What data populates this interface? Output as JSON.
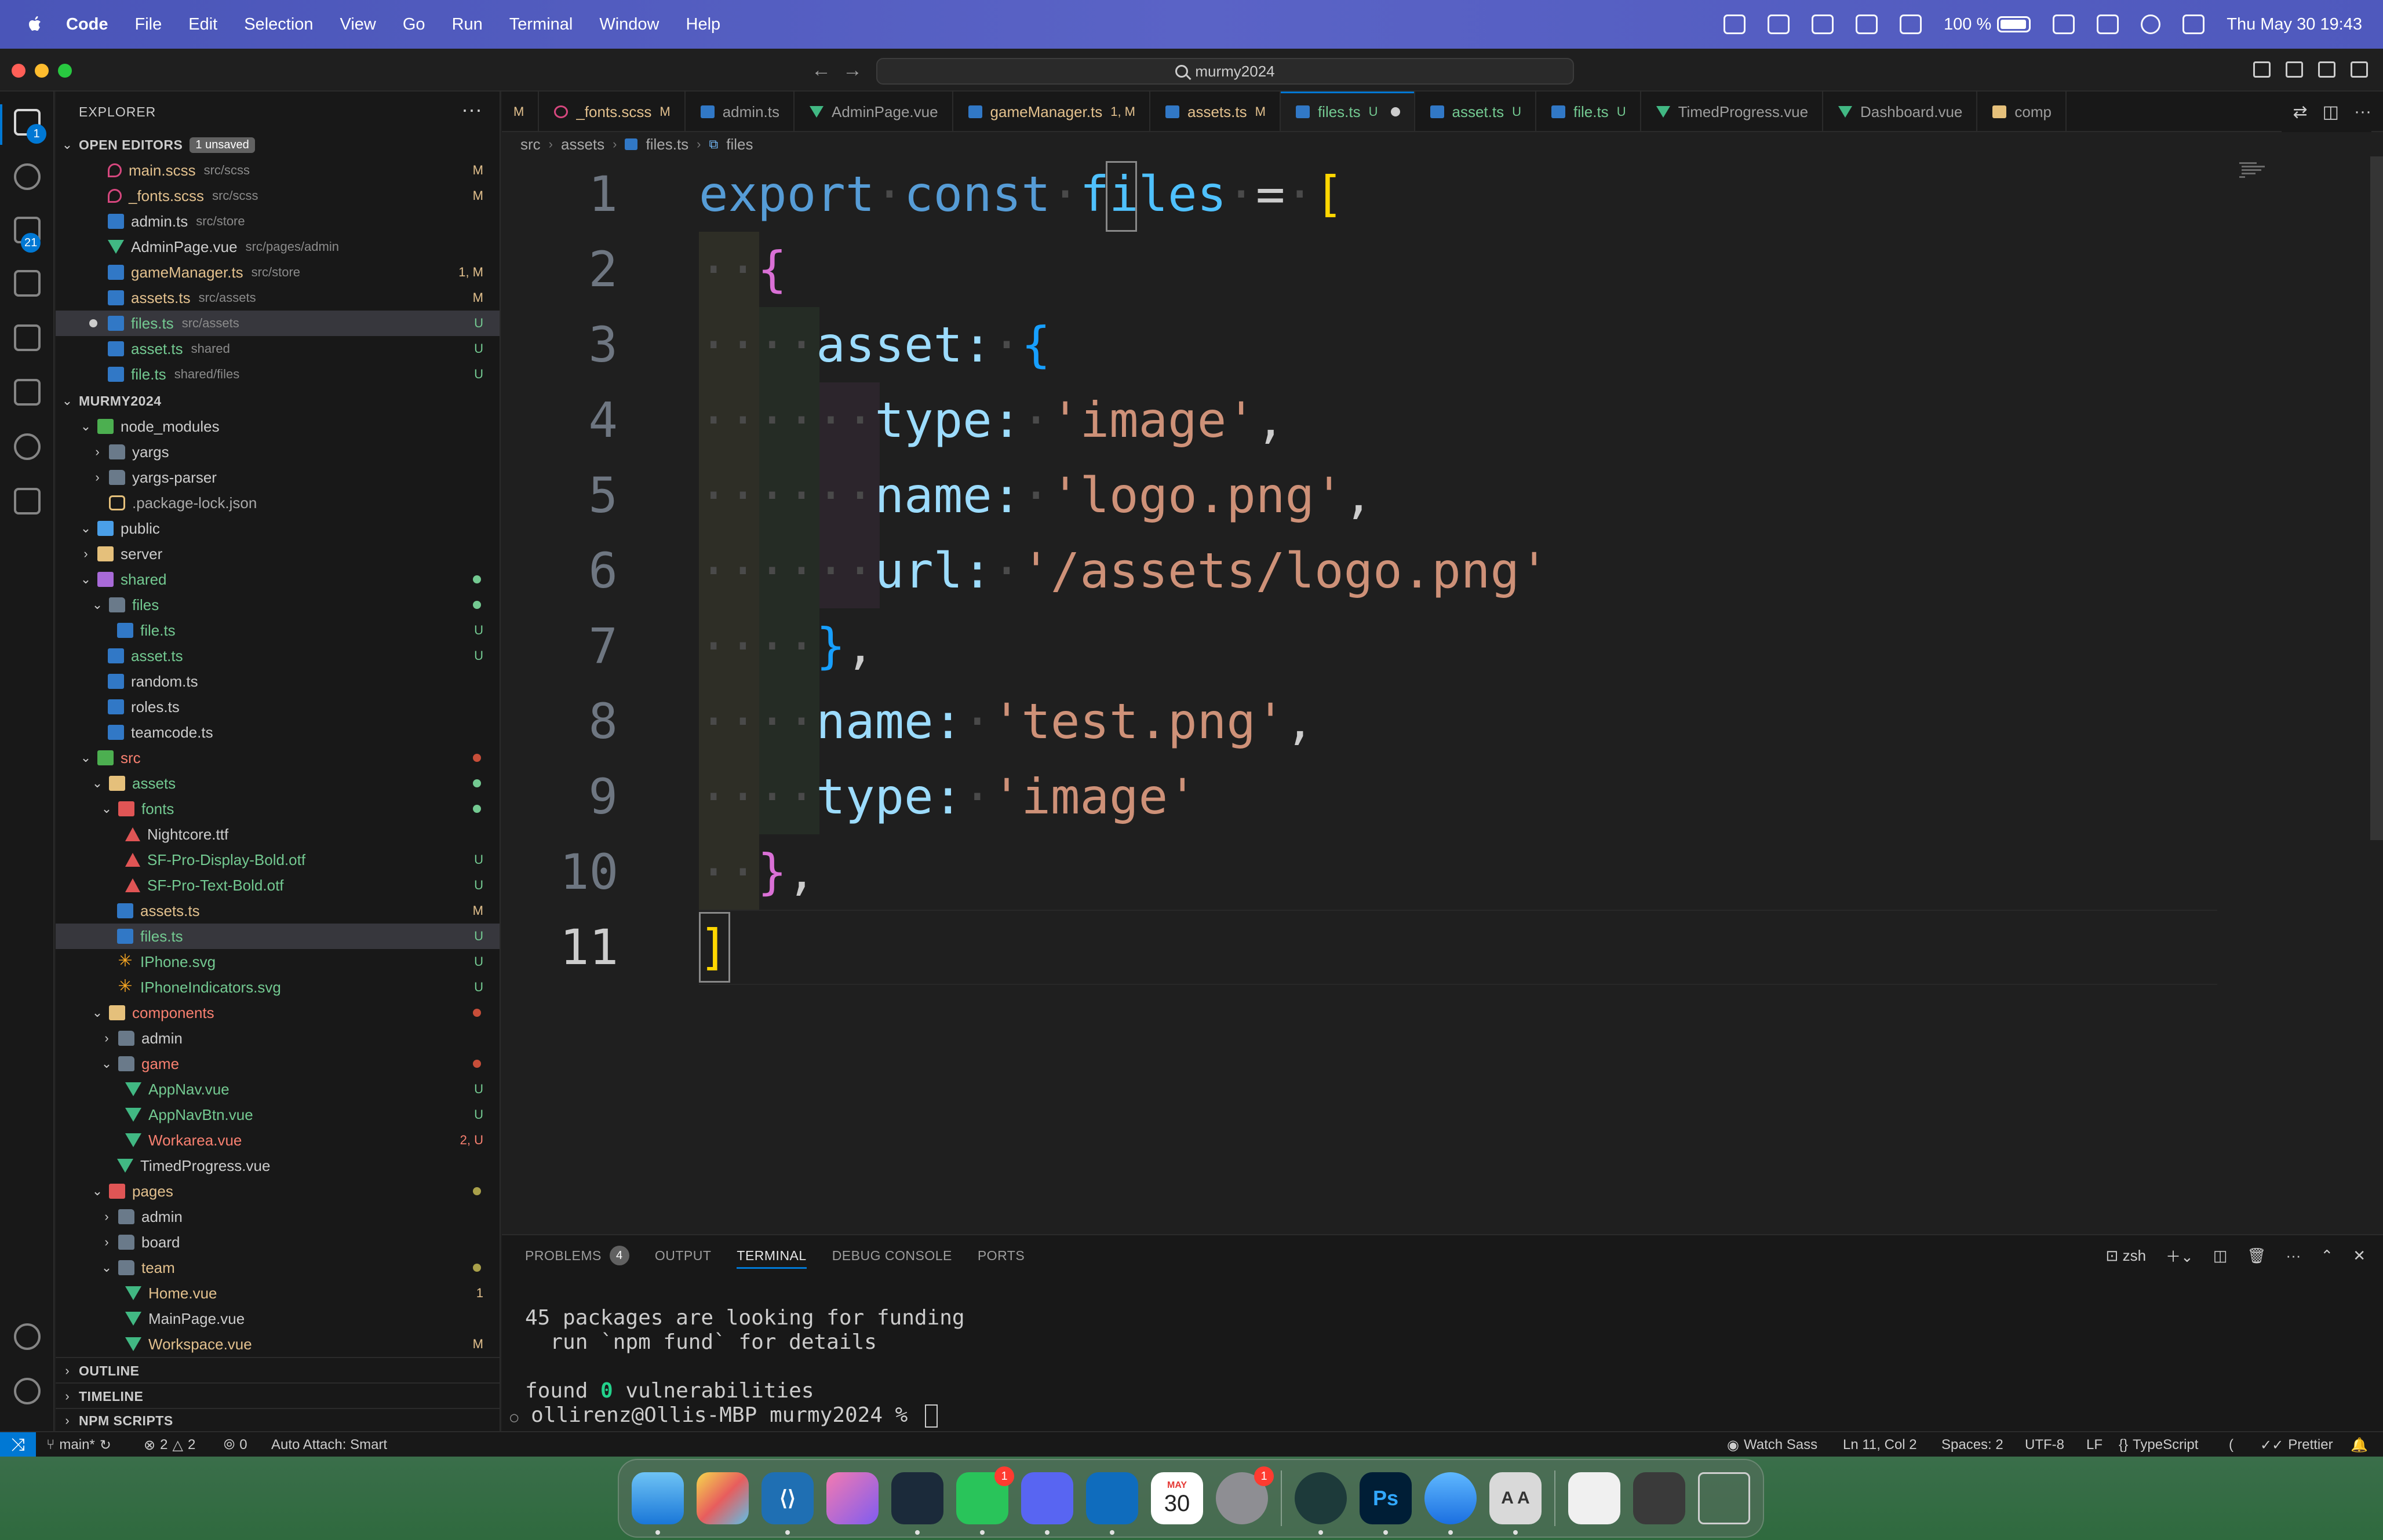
{
  "menubar": {
    "app_name": "Code",
    "menus": [
      "File",
      "Edit",
      "Selection",
      "View",
      "Go",
      "Run",
      "Terminal",
      "Window",
      "Help"
    ],
    "battery": "100 %",
    "datetime": "Thu May 30  19:43"
  },
  "titlebar": {
    "search": "murmy2024"
  },
  "activitybar": {
    "explorer_badge": "1",
    "scm_badge": "21"
  },
  "sidebar": {
    "title": "EXPLORER",
    "open_editors": {
      "label": "OPEN EDITORS",
      "badge": "1 unsaved",
      "items": [
        {
          "name": "main.scss",
          "desc": "src/scss",
          "status": "M"
        },
        {
          "name": "_fonts.scss",
          "desc": "src/scss",
          "status": "M"
        },
        {
          "name": "admin.ts",
          "desc": "src/store",
          "status": ""
        },
        {
          "name": "AdminPage.vue",
          "desc": "src/pages/admin",
          "status": ""
        },
        {
          "name": "gameManager.ts",
          "desc": "src/store",
          "status": "1, M"
        },
        {
          "name": "assets.ts",
          "desc": "src/assets",
          "status": "M"
        },
        {
          "name": "files.ts",
          "desc": "src/assets",
          "status": "U"
        },
        {
          "name": "asset.ts",
          "desc": "shared",
          "status": "U"
        },
        {
          "name": "file.ts",
          "desc": "shared/files",
          "status": "U"
        }
      ]
    },
    "workspace": {
      "label": "MURMY2024",
      "tree": [
        {
          "name": "node_modules",
          "status": ""
        },
        {
          "name": "yargs",
          "status": ""
        },
        {
          "name": "yargs-parser",
          "status": ""
        },
        {
          "name": ".package-lock.json",
          "status": ""
        },
        {
          "name": "public",
          "status": ""
        },
        {
          "name": "server",
          "status": ""
        },
        {
          "name": "shared",
          "status": ""
        },
        {
          "name": "files",
          "status": ""
        },
        {
          "name": "file.ts",
          "status": "U"
        },
        {
          "name": "asset.ts",
          "status": "U"
        },
        {
          "name": "random.ts",
          "status": ""
        },
        {
          "name": "roles.ts",
          "status": ""
        },
        {
          "name": "teamcode.ts",
          "status": ""
        },
        {
          "name": "src",
          "status": ""
        },
        {
          "name": "assets",
          "status": ""
        },
        {
          "name": "fonts",
          "status": ""
        },
        {
          "name": "Nightcore.ttf",
          "status": ""
        },
        {
          "name": "SF-Pro-Display-Bold.otf",
          "status": "U"
        },
        {
          "name": "SF-Pro-Text-Bold.otf",
          "status": "U"
        },
        {
          "name": "assets.ts",
          "status": "M"
        },
        {
          "name": "files.ts",
          "status": "U"
        },
        {
          "name": "IPhone.svg",
          "status": "U"
        },
        {
          "name": "IPhoneIndicators.svg",
          "status": "U"
        },
        {
          "name": "components",
          "status": ""
        },
        {
          "name": "admin",
          "status": ""
        },
        {
          "name": "game",
          "status": ""
        },
        {
          "name": "AppNav.vue",
          "status": "U"
        },
        {
          "name": "AppNavBtn.vue",
          "status": "U"
        },
        {
          "name": "Workarea.vue",
          "status": "2, U"
        },
        {
          "name": "TimedProgress.vue",
          "status": ""
        },
        {
          "name": "pages",
          "status": ""
        },
        {
          "name": "admin",
          "status": ""
        },
        {
          "name": "board",
          "status": ""
        },
        {
          "name": "team",
          "status": ""
        },
        {
          "name": "Home.vue",
          "status": "1"
        },
        {
          "name": "MainPage.vue",
          "status": ""
        },
        {
          "name": "Workspace.vue",
          "status": "M"
        }
      ]
    },
    "outline": "OUTLINE",
    "timeline": "TIMELINE",
    "npm_scripts": "NPM SCRIPTS"
  },
  "tabs": [
    {
      "label": "",
      "status": "M"
    },
    {
      "label": "_fonts.scss",
      "status": "M"
    },
    {
      "label": "admin.ts",
      "status": ""
    },
    {
      "label": "AdminPage.vue",
      "status": ""
    },
    {
      "label": "gameManager.ts",
      "status": "1, M"
    },
    {
      "label": "assets.ts",
      "status": "M"
    },
    {
      "label": "files.ts",
      "status": "U"
    },
    {
      "label": "asset.ts",
      "status": "U"
    },
    {
      "label": "file.ts",
      "status": "U"
    },
    {
      "label": "TimedProgress.vue",
      "status": ""
    },
    {
      "label": "Dashboard.vue",
      "status": ""
    },
    {
      "label": "comp",
      "status": ""
    }
  ],
  "breadcrumb": [
    "src",
    "assets",
    "files.ts",
    "files"
  ],
  "editor": {
    "line_numbers": [
      "1",
      "2",
      "3",
      "4",
      "5",
      "6",
      "7",
      "8",
      "9",
      "10",
      "11"
    ],
    "code": {
      "l1_kw": "export",
      "l1_kw2": "const",
      "l1_var": "files",
      "l1_eq": "=",
      "l1_br": "[",
      "l2_br": "{",
      "l3_prop": "asset:",
      "l3_br": "{",
      "l4_prop": "type:",
      "l4_str": "'image'",
      "l5_prop": "name:",
      "l5_str": "'logo.png'",
      "l6_prop": "url:",
      "l6_str": "'/assets/logo.png'",
      "l7_br": "}",
      "l8_prop": "name:",
      "l8_str": "'test.png'",
      "l9_prop": "type:",
      "l9_str": "'image'",
      "l10_br": "}",
      "l11_br": "]",
      "comma": ","
    }
  },
  "panel": {
    "tabs": [
      "PROBLEMS",
      "OUTPUT",
      "TERMINAL",
      "DEBUG CONSOLE",
      "PORTS"
    ],
    "problems_count": "4",
    "shell": "zsh",
    "terminal": {
      "line1": "45 packages are looking for funding",
      "line2": "  run `npm fund` for details",
      "line3_a": "found ",
      "line3_b": "0",
      "line3_c": " vulnerabilities",
      "prompt": "ollirenz@Ollis-MBP murmy2024 % "
    }
  },
  "statusbar": {
    "branch": "main*",
    "errors": "2",
    "warnings": "2",
    "ports": "0",
    "auto_attach": "Auto Attach: Smart",
    "watch_sass": "Watch Sass",
    "position": "Ln 11, Col 2",
    "spaces": "Spaces: 2",
    "encoding": "UTF-8",
    "eol": "LF",
    "language": "TypeScript",
    "prettier": "Prettier"
  },
  "dock": {
    "messages_badge": "1",
    "settings_badge": "1",
    "calendar_month": "MAY",
    "calendar_day": "30",
    "photoshop_label": "Ps",
    "fontbook_label": "A A"
  },
  "colors": {
    "accent": "#0078d4",
    "modified": "#e2c08d",
    "untracked": "#73c991",
    "error": "#f88070"
  }
}
